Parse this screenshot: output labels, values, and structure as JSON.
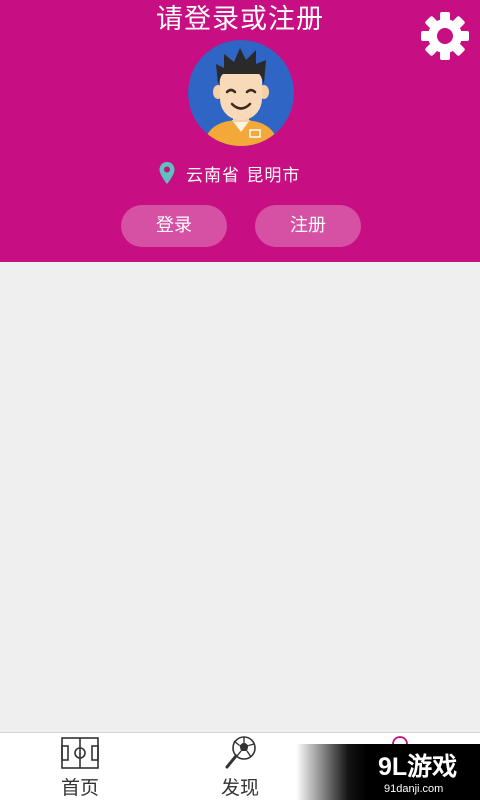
{
  "header": {
    "title": "请登录或注册",
    "settings_icon": "gear-icon",
    "background_color": "#c70e82"
  },
  "profile": {
    "avatar_icon": "cartoon-user-avatar",
    "location_icon": "map-pin-icon",
    "location_text": "云南省 昆明市"
  },
  "actions": {
    "login_label": "登录",
    "register_label": "注册"
  },
  "tabbar": {
    "tabs": [
      {
        "label": "首页",
        "icon": "soccer-field-icon"
      },
      {
        "label": "发现",
        "icon": "soccer-ball-search-icon"
      },
      {
        "label": "",
        "icon": "user-icon"
      }
    ]
  },
  "watermark": {
    "brand": "9L游戏",
    "site": "91danji.com"
  }
}
